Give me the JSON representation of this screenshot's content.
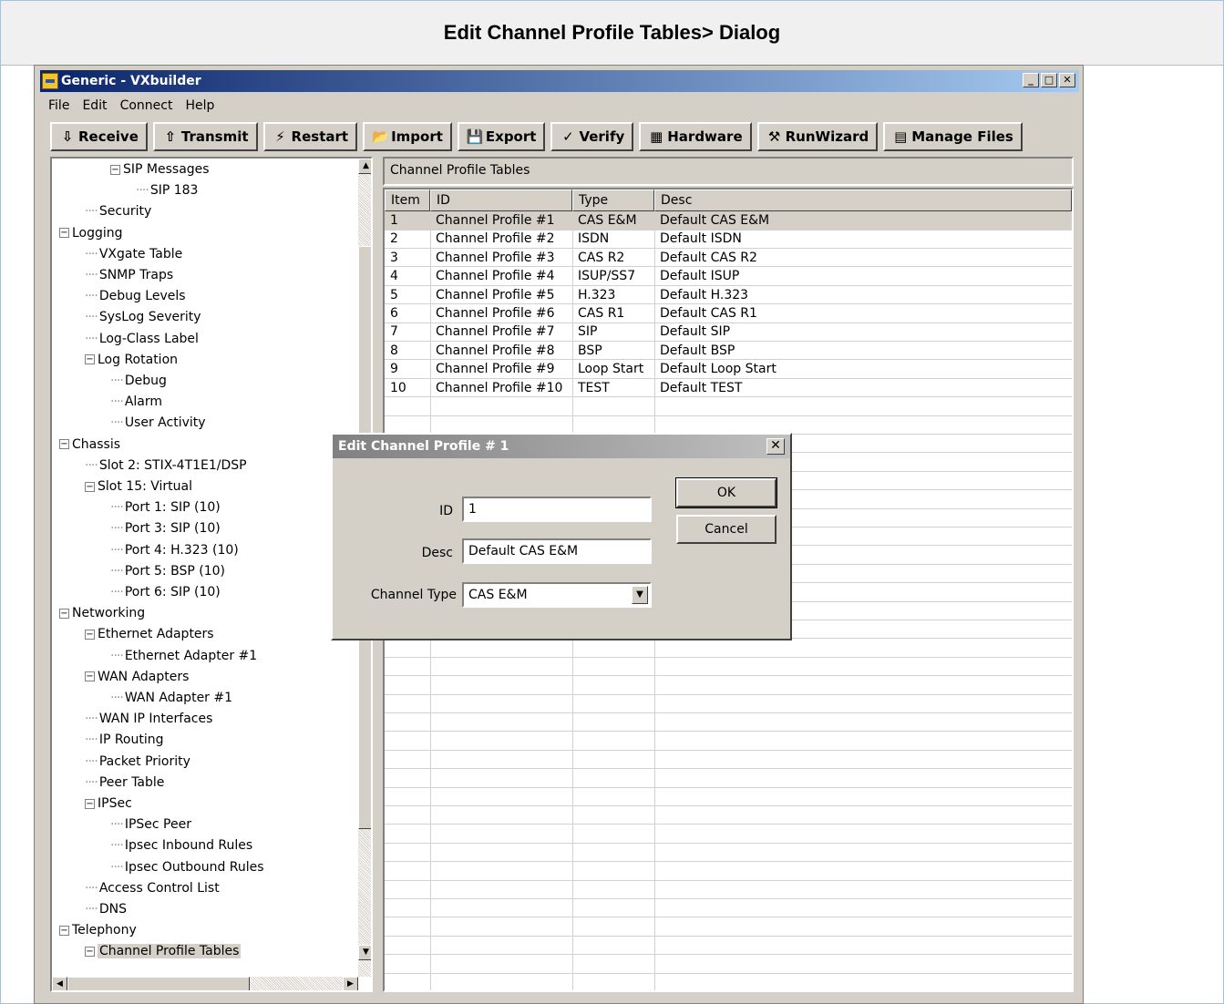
{
  "page_title": "Edit Channel Profile Tables> Dialog",
  "window": {
    "title": "Generic - VXbuilder",
    "min": "_",
    "max": "□",
    "close": "✕"
  },
  "menu": [
    "File",
    "Edit",
    "Connect",
    "Help"
  ],
  "toolbar": [
    {
      "label": "Receive",
      "icon": "⇩",
      "icon_name": "receive-icon"
    },
    {
      "label": "Transmit",
      "icon": "⇧",
      "icon_name": "transmit-icon"
    },
    {
      "label": "Restart",
      "icon": "⚡",
      "icon_name": "restart-icon"
    },
    {
      "label": "Import",
      "icon": "📂",
      "icon_name": "import-icon"
    },
    {
      "label": "Export",
      "icon": "💾",
      "icon_name": "export-icon"
    },
    {
      "label": "Verify",
      "icon": "✓",
      "icon_name": "verify-icon"
    },
    {
      "label": "Hardware",
      "icon": "▦",
      "icon_name": "hardware-icon"
    },
    {
      "label": "RunWizard",
      "icon": "⚒",
      "icon_name": "runwizard-icon"
    },
    {
      "label": "Manage Files",
      "icon": "▤",
      "icon_name": "manage-files-icon"
    }
  ],
  "tree": [
    {
      "label": "SIP Messages",
      "level": 3,
      "expander": "−"
    },
    {
      "label": "SIP 183",
      "level": 4
    },
    {
      "label": "Security",
      "level": 2
    },
    {
      "label": "Logging",
      "level": 1,
      "expander": "−"
    },
    {
      "label": "VXgate Table",
      "level": 2
    },
    {
      "label": "SNMP Traps",
      "level": 2
    },
    {
      "label": "Debug Levels",
      "level": 2
    },
    {
      "label": "SysLog Severity",
      "level": 2
    },
    {
      "label": "Log-Class Label",
      "level": 2
    },
    {
      "label": "Log Rotation",
      "level": 2,
      "expander": "−"
    },
    {
      "label": "Debug",
      "level": 3
    },
    {
      "label": "Alarm",
      "level": 3
    },
    {
      "label": "User Activity",
      "level": 3
    },
    {
      "label": "Chassis",
      "level": 1,
      "expander": "−"
    },
    {
      "label": "Slot 2: STIX-4T1E1/DSP",
      "level": 2
    },
    {
      "label": "Slot 15: Virtual",
      "level": 2,
      "expander": "−"
    },
    {
      "label": "Port 1: SIP (10)",
      "level": 3
    },
    {
      "label": "Port 3: SIP (10)",
      "level": 3
    },
    {
      "label": "Port 4: H.323 (10)",
      "level": 3
    },
    {
      "label": "Port 5: BSP (10)",
      "level": 3
    },
    {
      "label": "Port 6: SIP (10)",
      "level": 3
    },
    {
      "label": "Networking",
      "level": 1,
      "expander": "−"
    },
    {
      "label": "Ethernet Adapters",
      "level": 2,
      "expander": "−"
    },
    {
      "label": "Ethernet Adapter #1",
      "level": 3
    },
    {
      "label": "WAN Adapters",
      "level": 2,
      "expander": "−"
    },
    {
      "label": "WAN Adapter #1",
      "level": 3
    },
    {
      "label": "WAN IP Interfaces",
      "level": 2
    },
    {
      "label": "IP Routing",
      "level": 2
    },
    {
      "label": "Packet Priority",
      "level": 2
    },
    {
      "label": "Peer Table",
      "level": 2
    },
    {
      "label": "IPSec",
      "level": 2,
      "expander": "−"
    },
    {
      "label": "IPSec Peer",
      "level": 3
    },
    {
      "label": "Ipsec Inbound Rules",
      "level": 3
    },
    {
      "label": "Ipsec Outbound Rules",
      "level": 3
    },
    {
      "label": "Access Control List",
      "level": 2
    },
    {
      "label": "DNS",
      "level": 2
    },
    {
      "label": "Telephony",
      "level": 1,
      "expander": "−"
    },
    {
      "label": "Channel Profile Tables",
      "level": 2,
      "expander": "−",
      "selected": true
    }
  ],
  "panel": {
    "title": "Channel Profile Tables",
    "columns": [
      "Item",
      "ID",
      "Type",
      "Desc"
    ],
    "rows": [
      [
        "1",
        "Channel Profile #1",
        "CAS E&M",
        "Default CAS E&M"
      ],
      [
        "2",
        "Channel Profile #2",
        "ISDN",
        "Default ISDN"
      ],
      [
        "3",
        "Channel Profile #3",
        "CAS R2",
        "Default CAS R2"
      ],
      [
        "4",
        "Channel Profile #4",
        "ISUP/SS7",
        "Default ISUP"
      ],
      [
        "5",
        "Channel Profile #5",
        "H.323",
        "Default H.323"
      ],
      [
        "6",
        "Channel Profile #6",
        "CAS R1",
        "Default CAS R1"
      ],
      [
        "7",
        "Channel Profile #7",
        "SIP",
        "Default SIP"
      ],
      [
        "8",
        "Channel Profile #8",
        "BSP",
        "Default BSP"
      ],
      [
        "9",
        "Channel Profile #9",
        "Loop Start",
        "Default Loop Start"
      ],
      [
        "10",
        "Channel Profile #10",
        "TEST",
        "Default TEST"
      ]
    ]
  },
  "dialog": {
    "title": "Edit Channel Profile # 1",
    "close": "✕",
    "id_label": "ID",
    "id_value": "1",
    "desc_label": "Desc",
    "desc_value": "Default CAS E&M",
    "type_label": "Channel Type",
    "type_value": "CAS E&M",
    "ok": "OK",
    "cancel": "Cancel"
  }
}
